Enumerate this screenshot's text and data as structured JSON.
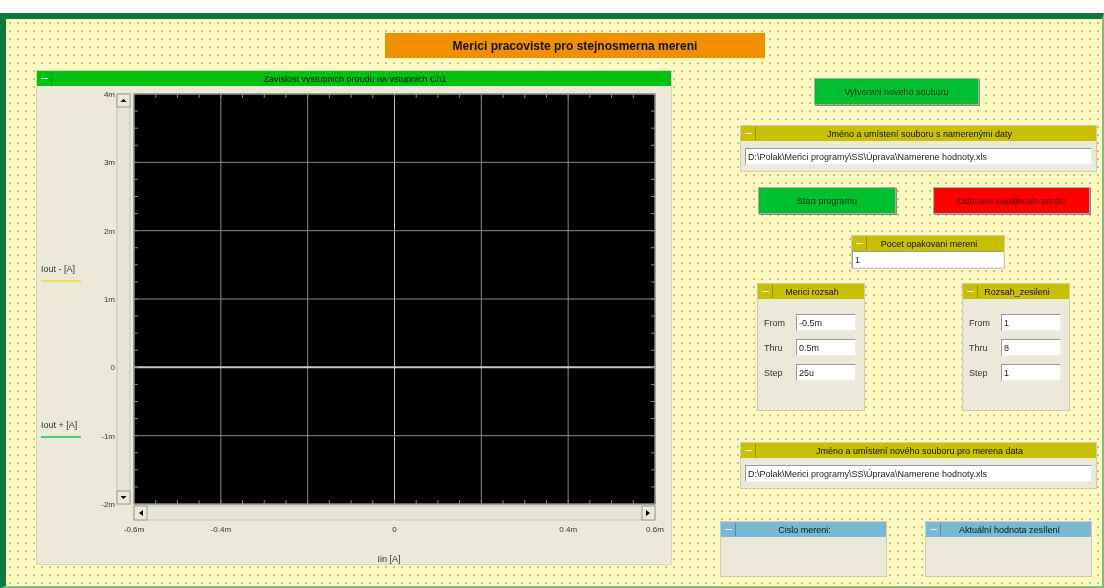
{
  "title": "Merici pracoviste pro stejnosmerna mereni",
  "graph": {
    "title": "Zavislost vystupnich proudu na vstupnich Ch1",
    "legend": [
      {
        "label": "Iout - [A]",
        "color": "#f0e040"
      },
      {
        "label": "Iout + [A]",
        "color": "#50d070"
      }
    ],
    "chart_data": {
      "type": "line",
      "grid": true,
      "xlabel": "Iin [A]",
      "xlim": [
        -0.6,
        0.6
      ],
      "ylim": [
        -2,
        4
      ],
      "xticks": [
        {
          "value": -0.6,
          "label": "-0.6m"
        },
        {
          "value": -0.4,
          "label": "-0.4m"
        },
        {
          "value": 0,
          "label": "0"
        },
        {
          "value": 0.4,
          "label": "0.4m"
        },
        {
          "value": 0.6,
          "label": "0.6m"
        }
      ],
      "yticks": [
        {
          "value": 4,
          "label": "4m"
        },
        {
          "value": 3,
          "label": "3m"
        },
        {
          "value": 2,
          "label": "2m"
        },
        {
          "value": 1,
          "label": "1m"
        },
        {
          "value": 0,
          "label": "0"
        },
        {
          "value": -1,
          "label": "-1m"
        },
        {
          "value": -2,
          "label": "-2m"
        }
      ]
    }
  },
  "create_button": {
    "label": "Vytvoreni noveho souboru",
    "kind": "go"
  },
  "file_panels": [
    {
      "title": "Jméno a umístení souboru s namerenými daty",
      "value": "D:\\Polak\\Merici programy\\SS\\Úprava\\Namerene hodnoty.xls"
    },
    {
      "title": "Jméno a umístení nového souboru pro merena data",
      "value": "D:\\Polak\\Merici programy\\SS\\Úprava\\Namerene hodnoty.xls"
    }
  ],
  "action_buttons": [
    {
      "label": "Start programu",
      "kind": "go"
    },
    {
      "label": "Odpojeni napájecich zdroju",
      "kind": "stop"
    }
  ],
  "repeat_count": {
    "title": "Pocet opakovani mereni",
    "value": "1"
  },
  "ranges": [
    {
      "title": "Merici rozsah",
      "rows": [
        {
          "label": "From",
          "value": "-0.5m"
        },
        {
          "label": "Thru",
          "value": "0.5m"
        },
        {
          "label": "Step",
          "value": "25u"
        }
      ]
    },
    {
      "title": "Rozsah_zesileni",
      "rows": [
        {
          "label": "From",
          "value": "1"
        },
        {
          "label": "Thru",
          "value": "8"
        },
        {
          "label": "Step",
          "value": "1"
        }
      ]
    }
  ],
  "displays": [
    {
      "title": "Cislo mereni:"
    },
    {
      "title": "Aktuální hodnota zesílení"
    }
  ]
}
